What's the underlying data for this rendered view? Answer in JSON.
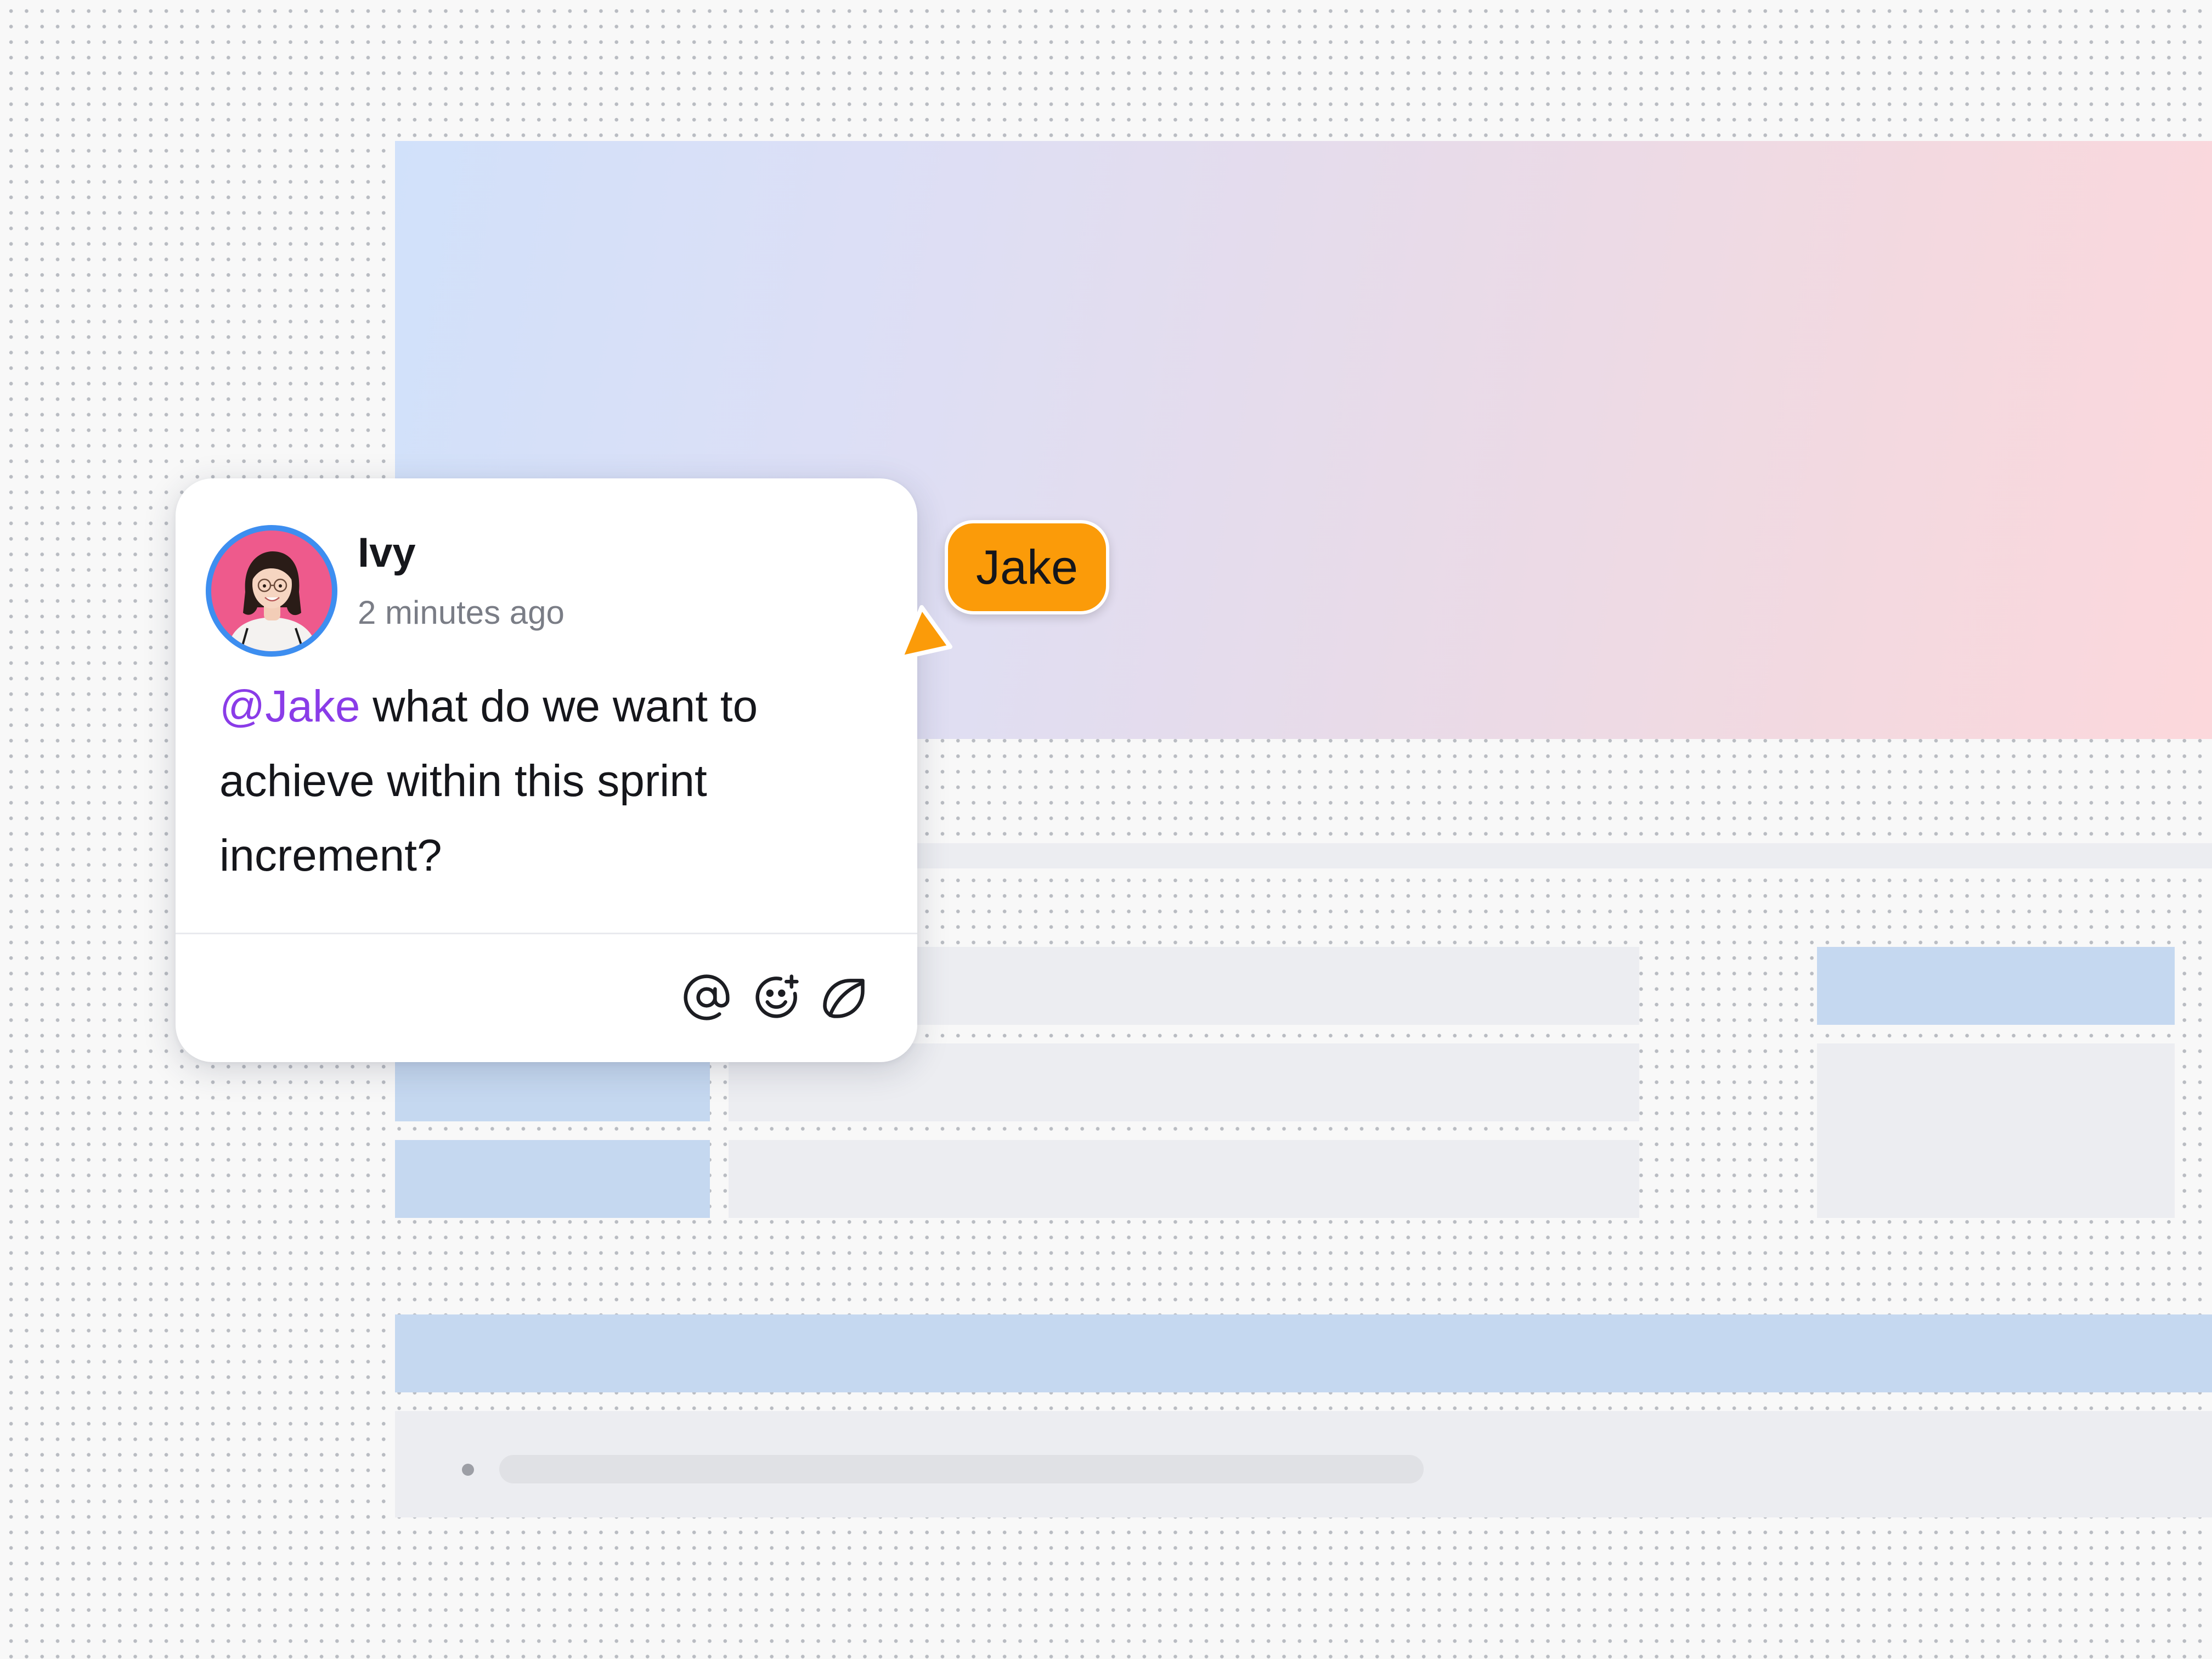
{
  "comment": {
    "author": "Ivy",
    "timestamp": "2 minutes ago",
    "mention": "@Jake",
    "message": " what do we want to achieve within this sprint increment?",
    "actions": [
      "mention-icon",
      "add-reaction-icon",
      "sticker-icon"
    ]
  },
  "collaborator_cursor": {
    "name": "Jake",
    "color": "#fb9b09"
  },
  "colors": {
    "mention": "#8a3ce8",
    "avatar_ring": "#3d8ef0",
    "avatar_background": "#ee5a8c",
    "banner_start": "#d1e1fa",
    "banner_end": "#fcd8dc",
    "placeholder_blue": "#c5d8f0",
    "placeholder_gray": "#ecedf1"
  }
}
